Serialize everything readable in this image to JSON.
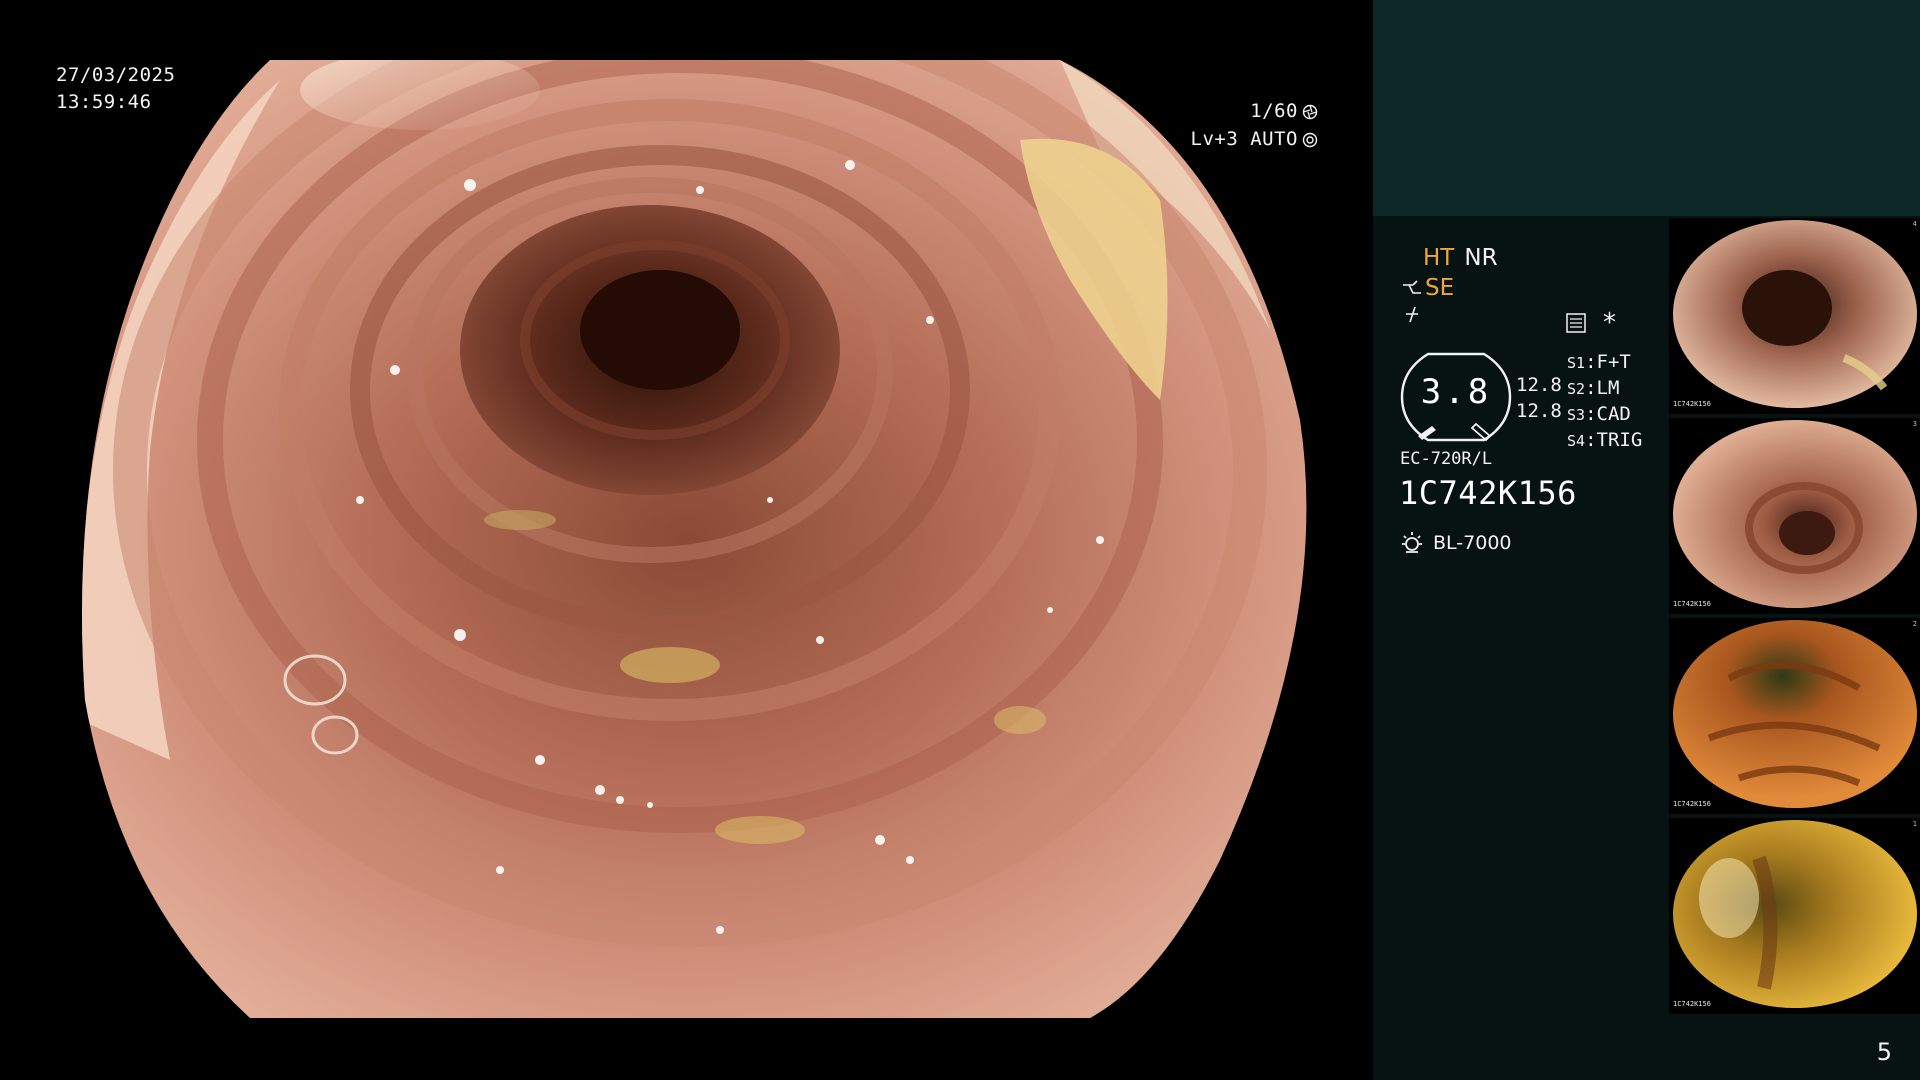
{
  "overlay": {
    "date": "27/03/2025",
    "time": "13:59:46",
    "shutter": "1/60",
    "shutter_icon": "shutter-icon",
    "level": "Lv+3 AUTO",
    "iris_icon": "iris-icon"
  },
  "panel": {
    "mode_ht": "HT",
    "mode_nr": "NR",
    "mode_se": "SE",
    "mode_se_icon": "enhancement-icon",
    "mode_extra_icon": "filter-icon",
    "record_icon": "record-icon",
    "asterisk": "*",
    "gauge_value": "3.8",
    "gauge_nums": [
      "12.8",
      "12.8"
    ],
    "switches": [
      {
        "key": "S1",
        "value": "F+T"
      },
      {
        "key": "S2",
        "value": "LM"
      },
      {
        "key": "S3",
        "value": "CAD"
      },
      {
        "key": "S4",
        "value": "TRIG"
      }
    ],
    "scope_model": "EC-720R/L",
    "scope_serial": "1C742K156",
    "light_source": "BL-7000",
    "light_icon": "lamp-icon"
  },
  "thumbnails": [
    {
      "index": "4",
      "label": "1C742K156"
    },
    {
      "index": "3",
      "label": "1C742K156"
    },
    {
      "index": "2",
      "label": "1C742K156"
    },
    {
      "index": "1",
      "label": "1C742K156"
    }
  ],
  "page_number": "5",
  "colors": {
    "accent_orange": "#f1a636",
    "panel_top": "#0c2725",
    "panel_bg": "#061312"
  }
}
